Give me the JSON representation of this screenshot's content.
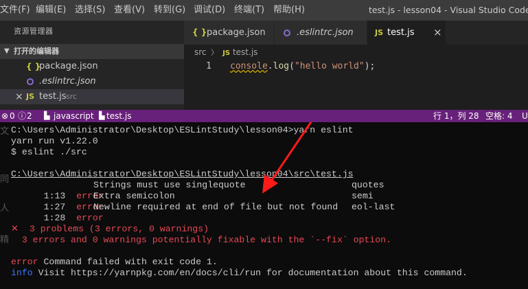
{
  "titlebar": {
    "menus": [
      "文件(F)",
      "编辑(E)",
      "选择(S)",
      "查看(V)",
      "转到(G)",
      "调试(D)",
      "终端(T)",
      "帮助(H)"
    ],
    "window_title": "test.js - lesson04 - Visual Studio Code"
  },
  "sidebar": {
    "title": "资源管理器",
    "section_label": "打开的编辑器",
    "items": [
      {
        "label": "package.json",
        "icon": "braces-icon"
      },
      {
        "label": ".eslintrc.json",
        "icon": "eslint-icon"
      },
      {
        "label": "test.js",
        "icon": "js-icon",
        "close": "×",
        "suffix": "src"
      }
    ]
  },
  "tabs": [
    {
      "label": "package.json",
      "icon": "{ }"
    },
    {
      "label": ".eslintrc.json",
      "icon": "eslint"
    },
    {
      "label": "test.js",
      "icon": "JS",
      "close": "×",
      "active": true
    }
  ],
  "editor": {
    "breadcrumb": {
      "folder": "src",
      "sep": "〉",
      "icon": "JS",
      "file": "test.js"
    },
    "line_number": "1",
    "code": {
      "obj": "console",
      "dot": ".",
      "method": "log",
      "open": "(",
      "str": "\"hello world\"",
      "close": ");"
    }
  },
  "statusbar": {
    "errors": "0",
    "warnings": "2",
    "language": "javascript",
    "file": "test.js",
    "position": "行 1，列 28",
    "spaces": "空格: 4",
    "encoding_stub": "U",
    "color": "#68217a"
  },
  "terminal": {
    "cmd_prompt": "C:\\Users\\Administrator\\Desktop\\ESLintStudy\\lesson04>yarn eslint",
    "yarn_run": "yarn run v1.22.0",
    "eslint_cmd": "$ eslint ./src",
    "file_path": "C:\\Users\\Administrator\\Desktop\\ESLintStudy\\lesson04\\src\\test.js",
    "problems": [
      {
        "pos": "1:13",
        "level": "error",
        "message": "Strings must use singlequote",
        "rule": "quotes"
      },
      {
        "pos": "1:27",
        "level": "error",
        "message": "Extra semicolon",
        "rule": "semi"
      },
      {
        "pos": "1:28",
        "level": "error",
        "message": "Newline required at end of file but not found",
        "rule": "eol-last"
      }
    ],
    "summary": "✕  3 problems (3 errors, 0 warnings)",
    "fixable": "  3 errors and 0 warnings potentially fixable with the `--fix` option.",
    "error_label": "error",
    "error_text": " Command failed with exit code 1.",
    "info_label": "info",
    "info_text": " Visit https://yarnpkg.com/en/docs/cli/run for documentation about this command.",
    "side_glyphs": [
      "文",
      "同",
      "人",
      "精"
    ],
    "error_color": "#e74856",
    "info_color": "#3b78ff"
  }
}
